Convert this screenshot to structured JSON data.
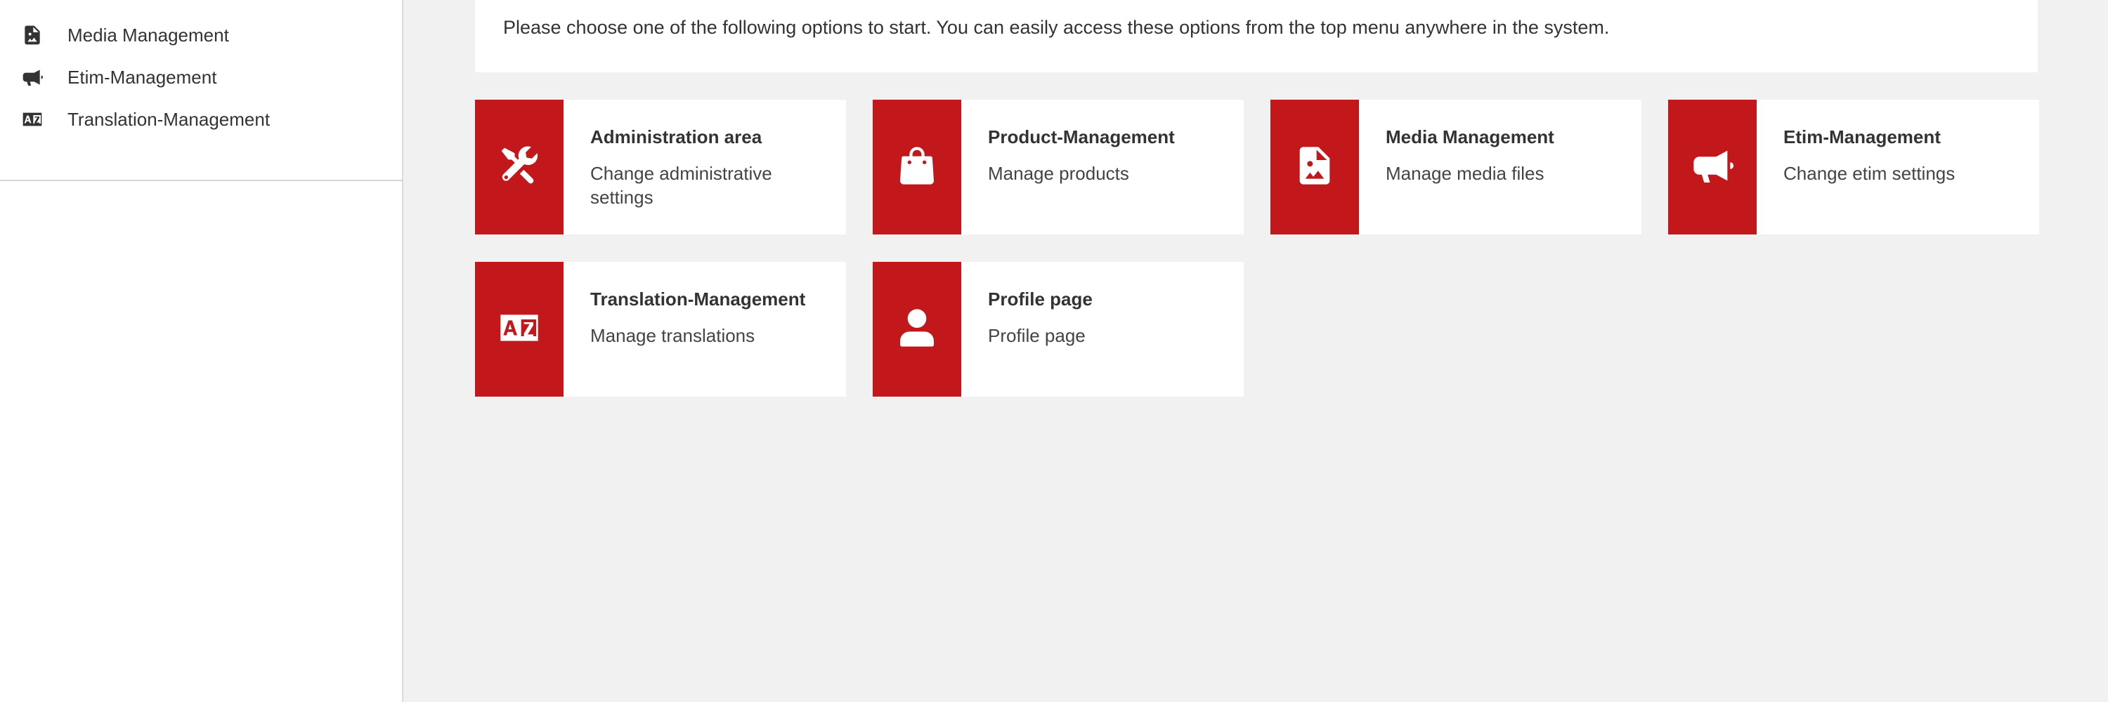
{
  "sidebar": {
    "items": [
      {
        "label": "Media Management",
        "icon": "file-image-icon"
      },
      {
        "label": "Etim-Management",
        "icon": "megaphone-icon"
      },
      {
        "label": "Translation-Management",
        "icon": "language-icon"
      }
    ]
  },
  "main": {
    "intro_text": "Please choose one of the following options to start. You can easily access these options from the top menu anywhere in the system."
  },
  "cards": [
    {
      "title": "Administration area",
      "description": "Change administrative settings",
      "icon": "tools-icon"
    },
    {
      "title": "Product-Management",
      "description": "Manage products",
      "icon": "shopping-bag-icon"
    },
    {
      "title": "Media Management",
      "description": "Manage media files",
      "icon": "file-image-icon"
    },
    {
      "title": "Etim-Management",
      "description": "Change etim settings",
      "icon": "megaphone-icon"
    },
    {
      "title": "Translation-Management",
      "description": "Manage translations",
      "icon": "language-icon"
    },
    {
      "title": "Profile page",
      "description": "Profile page",
      "icon": "user-icon"
    }
  ],
  "colors": {
    "accent": "#c2181b",
    "background": "#f1f1f1",
    "panel": "#ffffff",
    "text": "#333333"
  }
}
